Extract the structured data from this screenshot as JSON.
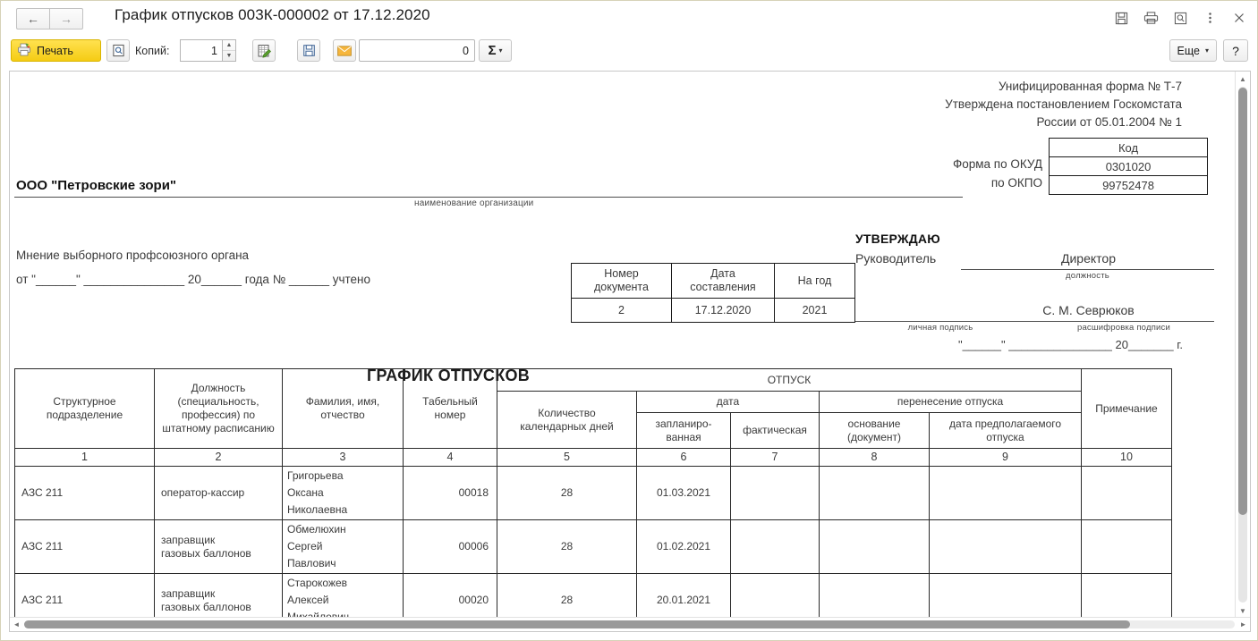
{
  "window": {
    "title": "График отпусков 003К-000002 от 17.12.2020",
    "nav": {
      "back": "←",
      "forward": "→"
    },
    "controls": [
      {
        "name": "save-icon",
        "glyph": "💾"
      },
      {
        "name": "print-icon",
        "glyph": "⎙"
      },
      {
        "name": "preview-icon",
        "glyph": "⌕"
      },
      {
        "name": "more-menu-icon",
        "glyph": "⋮"
      },
      {
        "name": "close-icon",
        "glyph": "×"
      }
    ]
  },
  "toolbar": {
    "print_label": "Печать",
    "copies_label": "Копий:",
    "copies_value": "1",
    "number_value": "0",
    "sum_label": "Σ",
    "more_label": "Еще",
    "help_label": "?",
    "dropdown_caret": "▾"
  },
  "form": {
    "header_lines": [
      "Унифицированная форма № Т-7",
      "Утверждена постановлением Госкомстата",
      "России от 05.01.2004 № 1"
    ],
    "code_header": "Код",
    "okud_label": "Форма по ОКУД",
    "okud_value": "0301020",
    "okpo_label": "по ОКПО",
    "okpo_value": "99752478",
    "org_name": "ООО \"Петровские зори\"",
    "org_caption": "наименование организации",
    "union_line1": "Мнение выборного профсоюзного органа",
    "union_line2": "от \"______\" _______________ 20______ года № ______ учтено",
    "big_title": "ГРАФИК ОТПУСКОВ",
    "docnum": {
      "col1": "Номер\nдокумента",
      "col1_a": "Номер",
      "col1_b": "документа",
      "col2_a": "Дата",
      "col2_b": "составления",
      "col3": "На год",
      "val1": "2",
      "val2": "17.12.2020",
      "val3": "2021"
    },
    "approve": {
      "title": "УТВЕРЖДАЮ",
      "leader_label": "Руководитель",
      "position_value": "Директор",
      "position_caption": "должность",
      "signature_caption": "личная подпись",
      "name_value": "С. М. Севрюков",
      "name_caption": "расшифровка подписи",
      "date_line": "\"______\" ________________ 20_______ г."
    }
  },
  "table": {
    "headers": {
      "h1": "Структурное\nподразделение",
      "h1_a": "Структурное",
      "h1_b": "подразделение",
      "h2": "Должность (специальность, профессия) по штатному расписанию",
      "h3_a": "Фамилия, имя,",
      "h3_b": "отчество",
      "h4_a": "Табельный",
      "h4_b": "номер",
      "vacation": "ОТПУСК",
      "h5_a": "Количество",
      "h5_b": "календарных дней",
      "date_group": "дата",
      "h6_a": "запланиро-",
      "h6_b": "ванная",
      "h7": "фактическая",
      "transfer_group": "перенесение отпуска",
      "h8_a": "основание",
      "h8_b": "(документ)",
      "h9_a": "дата предполагаемого",
      "h9_b": "отпуска",
      "h10": "Примечание"
    },
    "col_numbers": [
      "1",
      "2",
      "3",
      "4",
      "5",
      "6",
      "7",
      "8",
      "9",
      "10"
    ],
    "rows": [
      {
        "unit": "АЗС 211",
        "position": "оператор-кассир",
        "position_2": "",
        "name_1": "Григорьева",
        "name_2": "Оксана",
        "name_3": "Николаевна",
        "tab_number": "00018",
        "days": "28",
        "planned_date": "01.03.2021",
        "actual_date": "",
        "transfer_basis": "",
        "transfer_date": "",
        "note": ""
      },
      {
        "unit": "АЗС 211",
        "position": "заправщик",
        "position_2": "газовых баллонов",
        "name_1": "Обмелюхин",
        "name_2": "Сергей",
        "name_3": "Павлович",
        "tab_number": "00006",
        "days": "28",
        "planned_date": "01.02.2021",
        "actual_date": "",
        "transfer_basis": "",
        "transfer_date": "",
        "note": ""
      },
      {
        "unit": "АЗС 211",
        "position": "заправщик",
        "position_2": "газовых баллонов",
        "name_1": "Старокожев",
        "name_2": "Алексей",
        "name_3": "Михайлович",
        "tab_number": "00020",
        "days": "28",
        "planned_date": "20.01.2021",
        "actual_date": "",
        "transfer_basis": "",
        "transfer_date": "",
        "note": ""
      }
    ]
  },
  "scroll": {
    "v_up": "▲",
    "v_down": "▼",
    "h_left": "◄",
    "h_right": "►"
  }
}
